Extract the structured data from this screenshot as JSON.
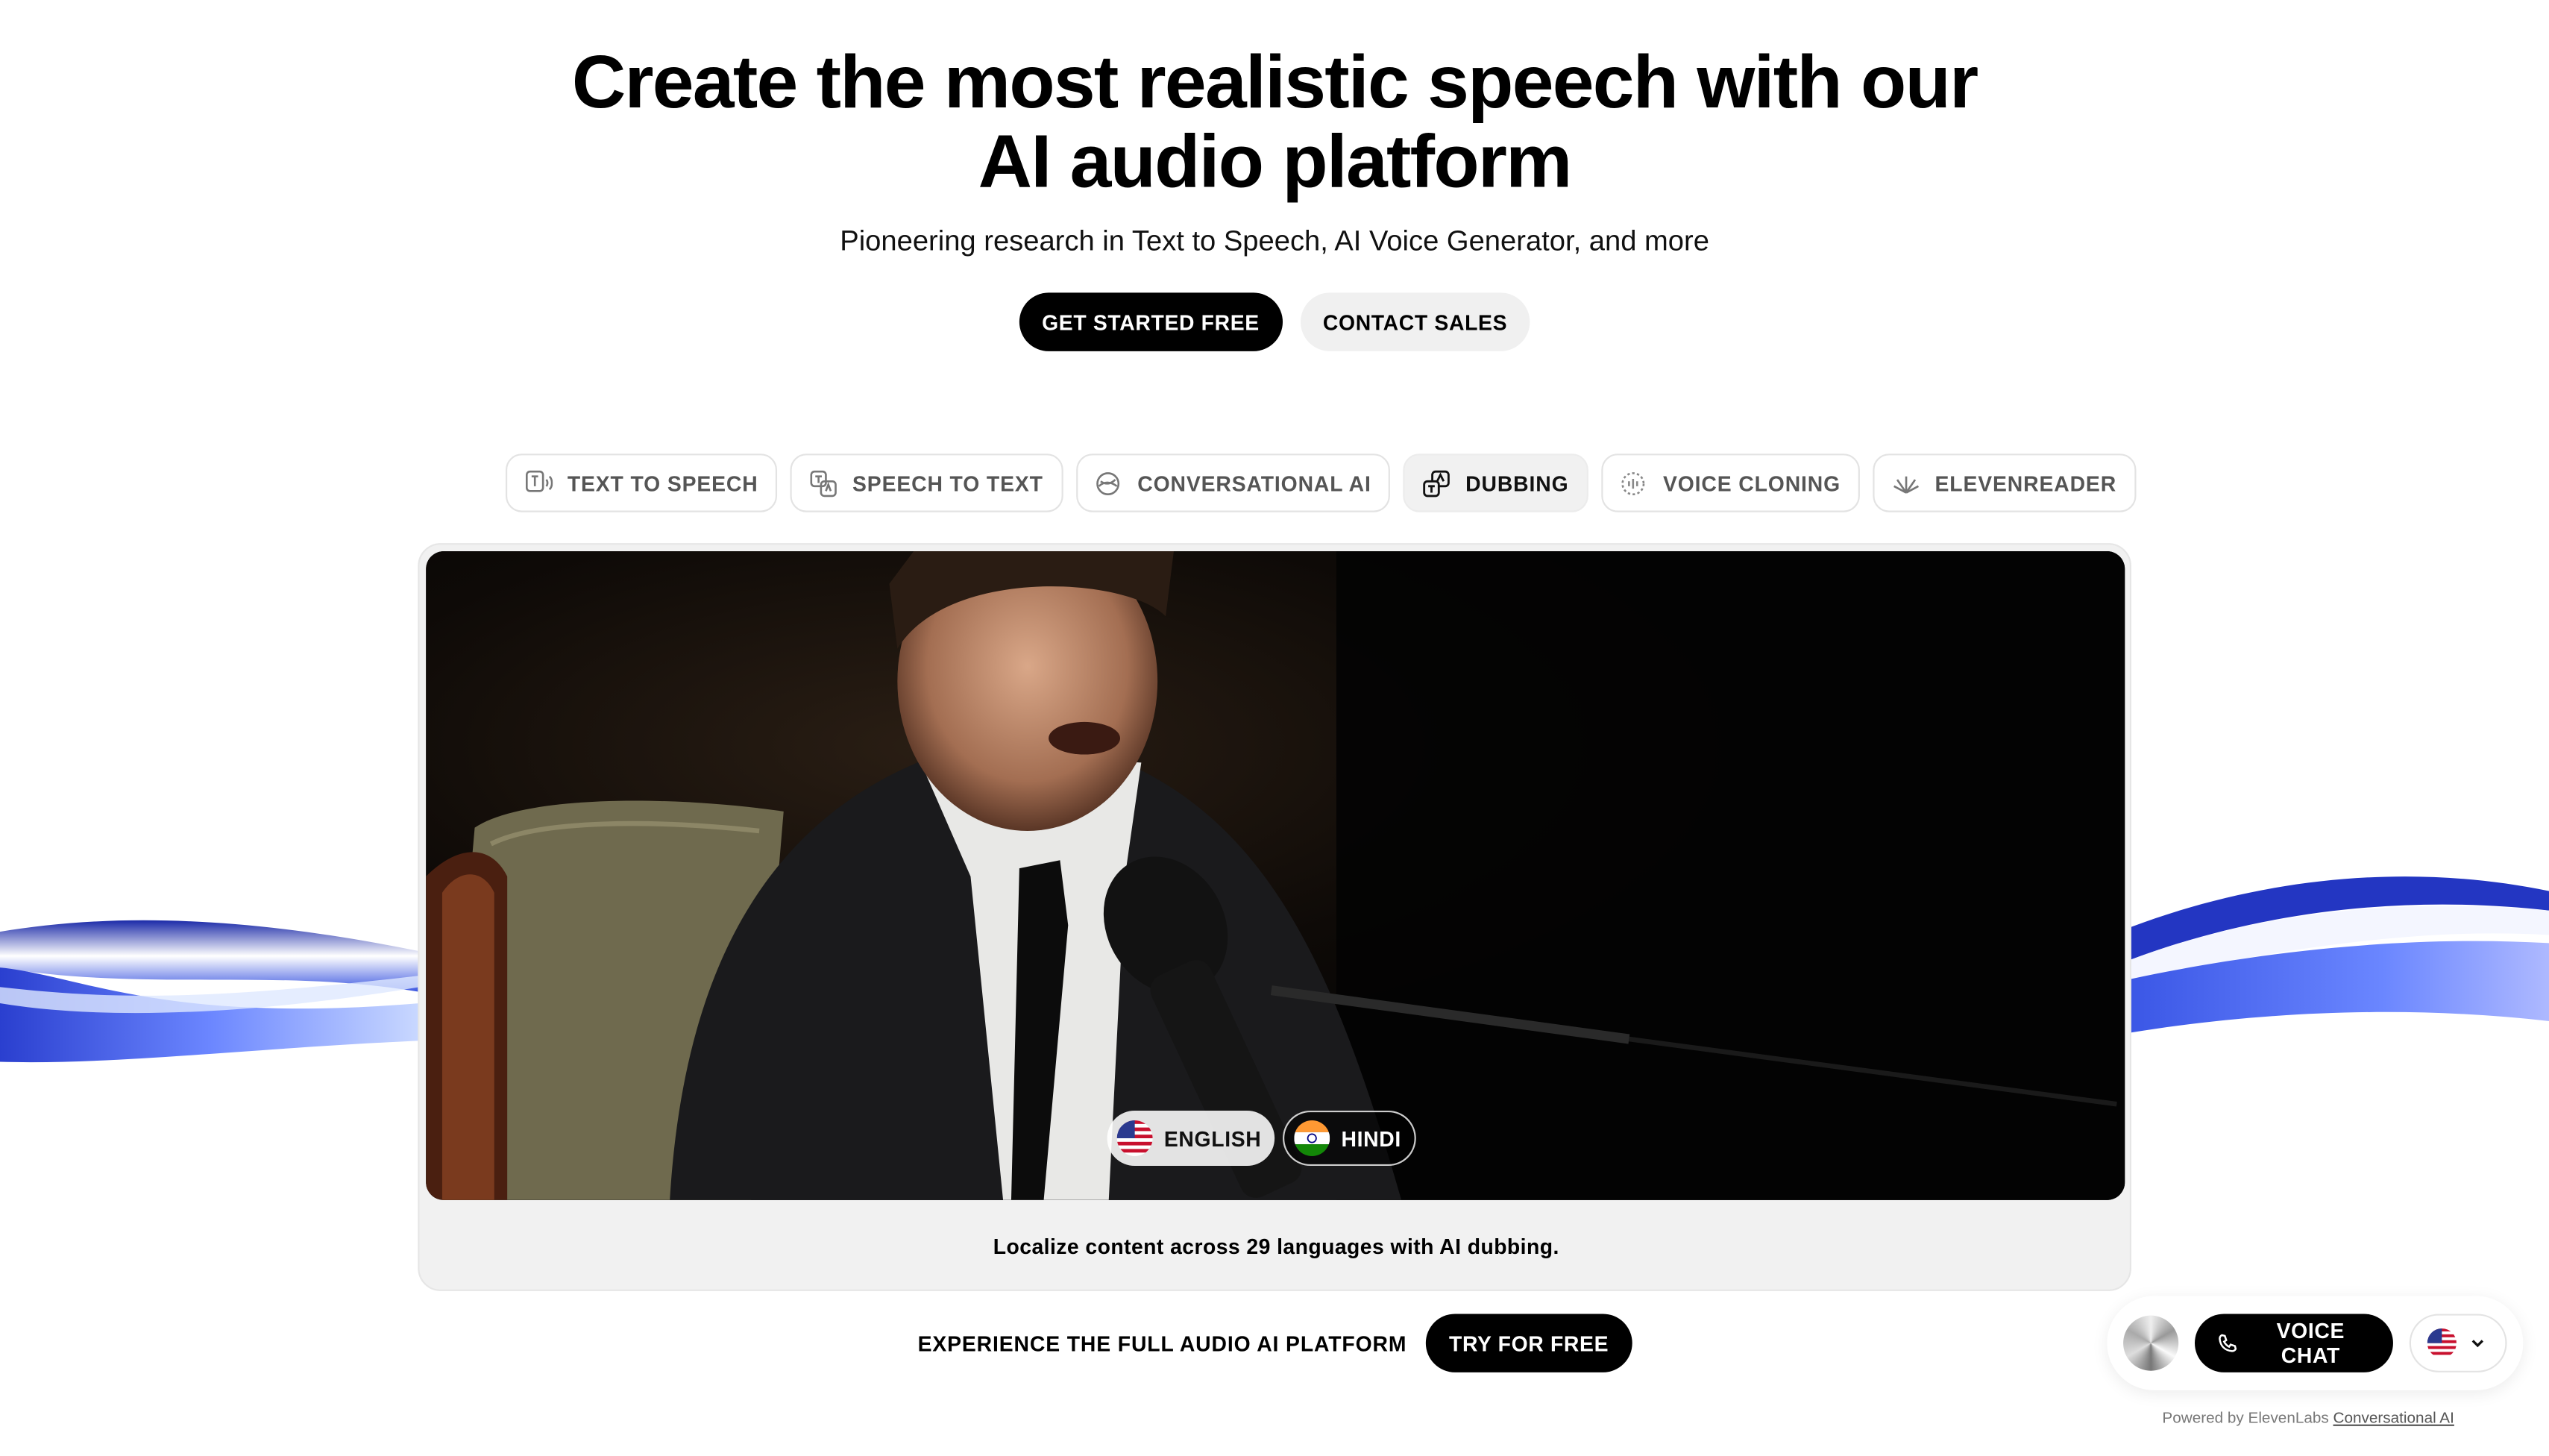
{
  "hero": {
    "title_line1": "Create the most realistic speech with our",
    "title_line2": "AI audio platform",
    "subtitle": "Pioneering research in Text to Speech, AI Voice Generator, and more",
    "primary_cta": "GET STARTED FREE",
    "secondary_cta": "CONTACT SALES"
  },
  "tabs": [
    {
      "label": "TEXT TO SPEECH",
      "icon": "text-to-speech-icon"
    },
    {
      "label": "SPEECH TO TEXT",
      "icon": "speech-to-text-icon"
    },
    {
      "label": "CONVERSATIONAL AI",
      "icon": "conversational-ai-icon"
    },
    {
      "label": "DUBBING",
      "icon": "dubbing-icon",
      "active": true
    },
    {
      "label": "VOICE CLONING",
      "icon": "voice-cloning-icon"
    },
    {
      "label": "ELEVENREADER",
      "icon": "elevenreader-icon"
    }
  ],
  "demo": {
    "languages": [
      "ENGLISH",
      "HINDI"
    ],
    "selected_language": "ENGLISH",
    "caption": "Localize content across 29 languages with AI dubbing."
  },
  "bottom": {
    "label": "EXPERIENCE THE FULL AUDIO AI PLATFORM",
    "cta": "TRY FOR FREE"
  },
  "widget": {
    "voice_chat": "VOICE CHAT",
    "powered_prefix": "Powered by ElevenLabs",
    "powered_link": "Conversational AI"
  },
  "colors": {
    "accent_dark": "#000000",
    "wave_blue": "#3b5bdb"
  }
}
